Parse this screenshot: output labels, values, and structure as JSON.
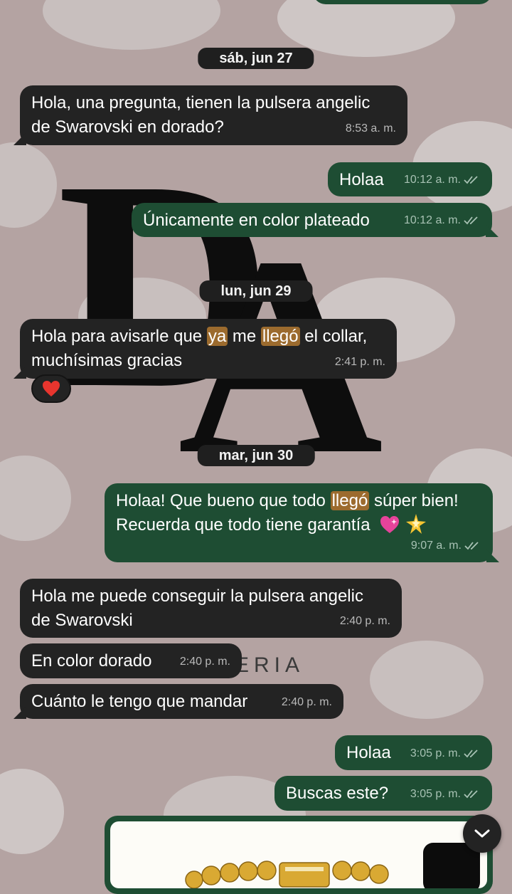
{
  "colors": {
    "background": "#b4a3a2",
    "incoming_bubble": "#232323",
    "outgoing_bubble": "#1e4d33",
    "highlight": "#9c6b2e"
  },
  "wallpaper": {
    "brand_word": "ERIA"
  },
  "dates": {
    "d1": "sáb, jun 27",
    "d2": "lun, jun 29",
    "d3": "mar, jun 30"
  },
  "messages": [
    {
      "dir": "in",
      "text_1": "Hola, una pregunta, tienen la pulsera angelic",
      "text_2": "de Swarovski en dorado?",
      "time": "8:53 a. m."
    },
    {
      "dir": "out",
      "text": "Holaa",
      "time": "10:12 a. m.",
      "status": "read"
    },
    {
      "dir": "out",
      "text": "Únicamente en color plateado",
      "time": "10:12 a. m.",
      "status": "read"
    },
    {
      "dir": "in",
      "parts": [
        "Hola para avisarle que ",
        "ya",
        " me ",
        "llegó",
        " el collar,"
      ],
      "text_2": "muchísimas gracias",
      "time": "2:41 p. m.",
      "reaction": "heart"
    },
    {
      "dir": "out",
      "parts": [
        "Holaa! Que bueno que todo ",
        "llegó",
        " súper bien!"
      ],
      "text_2": "Recuerda que todo tiene garantía",
      "emoji": [
        "sparkling-heart",
        "glowing-star"
      ],
      "time": "9:07 a. m.",
      "status": "read"
    },
    {
      "dir": "in",
      "text_1": "Hola me puede conseguir la pulsera angelic",
      "text_2": "de Swarovski",
      "time": "2:40 p. m."
    },
    {
      "dir": "in",
      "text": "En color dorado",
      "time": "2:40 p. m."
    },
    {
      "dir": "in",
      "text": "Cuánto le tengo que mandar",
      "time": "2:40 p. m."
    },
    {
      "dir": "out",
      "text": "Holaa",
      "time": "3:05 p. m.",
      "status": "read"
    },
    {
      "dir": "out",
      "text": "Buscas este?",
      "time": "3:05 p. m.",
      "status": "read"
    },
    {
      "dir": "out",
      "type": "image",
      "icon": "bracelet-photo"
    }
  ],
  "controls": {
    "scroll_down_icon": "chevron-down-icon"
  }
}
